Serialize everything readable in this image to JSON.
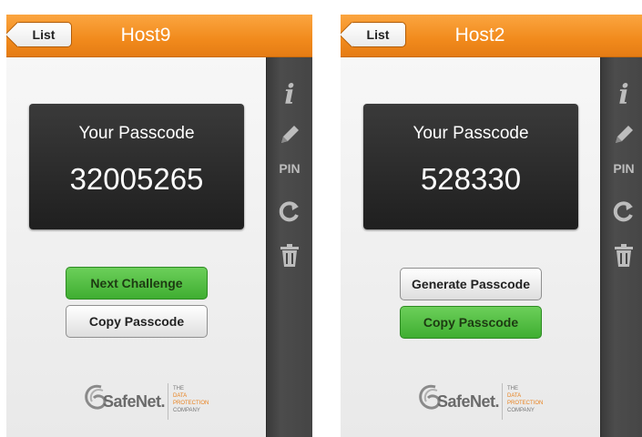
{
  "screens": [
    {
      "back_label": "List",
      "title": "Host9",
      "passcode_label": "Your Passcode",
      "passcode": "32005265",
      "buttons": [
        {
          "label": "Next Challenge",
          "style": "green"
        },
        {
          "label": "Copy Passcode",
          "style": "white"
        }
      ]
    },
    {
      "back_label": "List",
      "title": "Host2",
      "passcode_label": "Your Passcode",
      "passcode": "528330",
      "buttons": [
        {
          "label": "Generate Passcode",
          "style": "white"
        },
        {
          "label": "Copy Passcode",
          "style": "green"
        }
      ]
    }
  ],
  "sidebar": {
    "icons": [
      "info-icon",
      "pencil-icon",
      "pin-icon",
      "refresh-icon",
      "trash-icon"
    ],
    "pin_label": "PIN",
    "info_glyph": "i"
  },
  "branding": {
    "name": "SafeNet.",
    "tagline": [
      "THE",
      "DATA",
      "PROTECTION",
      "COMPANY"
    ]
  },
  "colors": {
    "title_bar": "#f18a1c",
    "green_button": "#3fae31",
    "sidebar": "#454545",
    "passcode_box": "#2a2a2a"
  }
}
